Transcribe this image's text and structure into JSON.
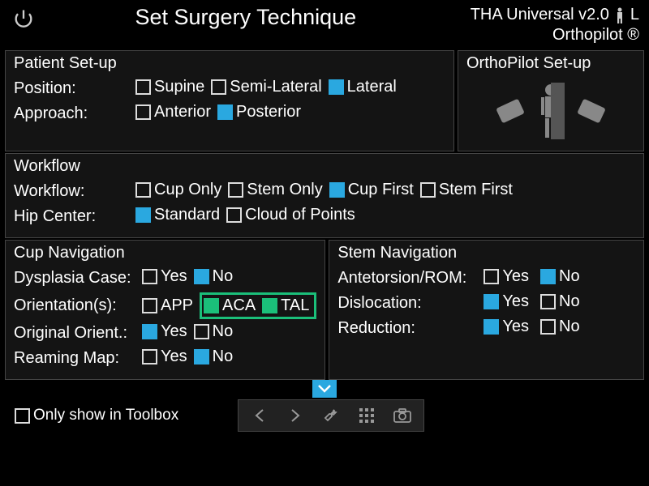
{
  "header": {
    "title": "Set Surgery Technique",
    "version": "THA Universal v2.0",
    "side": "L",
    "brand": "Orthopilot ®"
  },
  "patient_setup": {
    "title": "Patient Set-up",
    "position_label": "Position:",
    "position_opts": [
      {
        "label": "Supine",
        "sel": false
      },
      {
        "label": "Semi-Lateral",
        "sel": false
      },
      {
        "label": "Lateral",
        "sel": true
      }
    ],
    "approach_label": "Approach:",
    "approach_opts": [
      {
        "label": "Anterior",
        "sel": false
      },
      {
        "label": "Posterior",
        "sel": true
      }
    ]
  },
  "ortho_setup": {
    "title": "OrthoPilot Set-up"
  },
  "workflow": {
    "title": "Workflow",
    "workflow_label": "Workflow:",
    "workflow_opts": [
      {
        "label": "Cup Only",
        "sel": false
      },
      {
        "label": "Stem Only",
        "sel": false
      },
      {
        "label": "Cup First",
        "sel": true
      },
      {
        "label": "Stem First",
        "sel": false
      }
    ],
    "hipcenter_label": "Hip Center:",
    "hipcenter_opts": [
      {
        "label": "Standard",
        "sel": true
      },
      {
        "label": "Cloud of Points",
        "sel": false
      }
    ]
  },
  "cup_nav": {
    "title": "Cup Navigation",
    "rows": {
      "dysplasia": {
        "label": "Dysplasia Case:",
        "opts": [
          {
            "label": "Yes",
            "sel": false
          },
          {
            "label": "No",
            "sel": true
          }
        ]
      },
      "orient": {
        "label": "Orientation(s):",
        "app": {
          "label": "APP",
          "sel": false
        },
        "aca": {
          "label": "ACA",
          "sel": true
        },
        "tal": {
          "label": "TAL",
          "sel": true
        }
      },
      "orig": {
        "label": "Original Orient.:",
        "opts": [
          {
            "label": "Yes",
            "sel": true
          },
          {
            "label": "No",
            "sel": false
          }
        ]
      },
      "ream": {
        "label": "Reaming Map:",
        "opts": [
          {
            "label": "Yes",
            "sel": false
          },
          {
            "label": "No",
            "sel": true
          }
        ]
      }
    }
  },
  "stem_nav": {
    "title": "Stem Navigation",
    "rows": {
      "ante": {
        "label": "Antetorsion/ROM:",
        "opts": [
          {
            "label": "Yes",
            "sel": false
          },
          {
            "label": "No",
            "sel": true
          }
        ]
      },
      "disloc": {
        "label": "Dislocation:",
        "opts": [
          {
            "label": "Yes",
            "sel": true
          },
          {
            "label": "No",
            "sel": false
          }
        ]
      },
      "reduc": {
        "label": "Reduction:",
        "opts": [
          {
            "label": "Yes",
            "sel": true
          },
          {
            "label": "No",
            "sel": false
          }
        ]
      }
    }
  },
  "footer": {
    "only_toolbox": "Only show in Toolbox"
  }
}
